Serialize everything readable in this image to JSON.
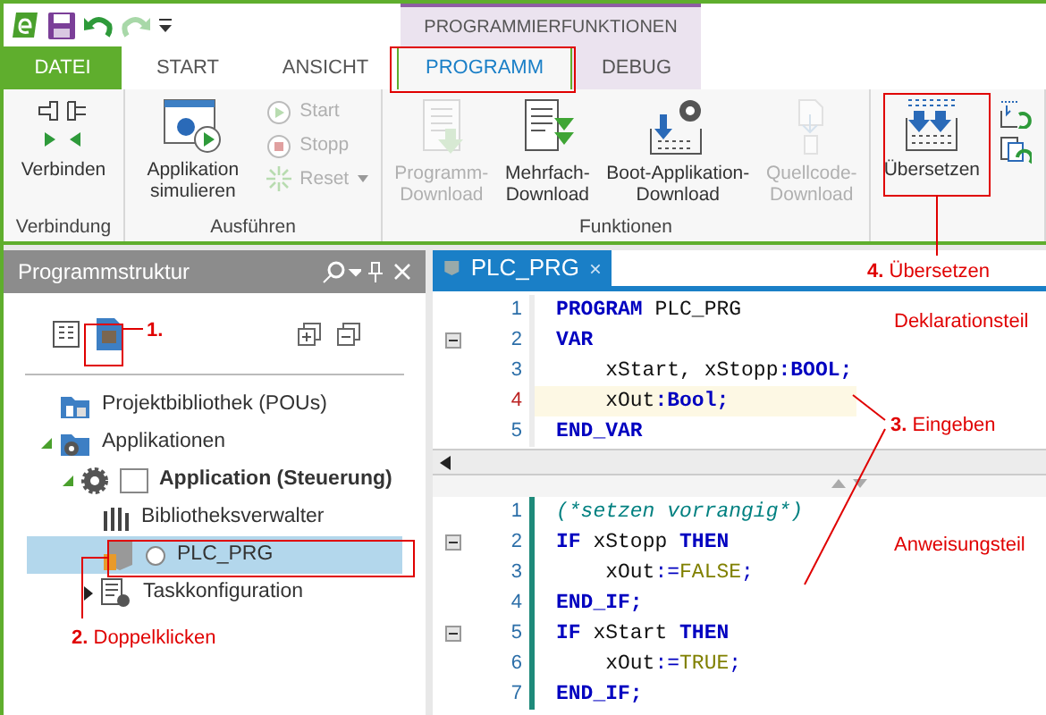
{
  "context_tab_group": "PROGRAMMIERFUNKTIONEN",
  "tabs": [
    {
      "label": "DATEI",
      "kind": "file",
      "selected": false
    },
    {
      "label": "START",
      "kind": "normal",
      "selected": false
    },
    {
      "label": "ANSICHT",
      "kind": "normal",
      "selected": false
    },
    {
      "label": "PROGRAMM",
      "kind": "context",
      "selected": true
    },
    {
      "label": "DEBUG",
      "kind": "context",
      "selected": false
    }
  ],
  "ribbon_groups": [
    {
      "label": "Verbindung",
      "items": [
        {
          "kind": "connect",
          "label": "Verbinden",
          "disabled": false
        }
      ]
    },
    {
      "label": "Ausführen",
      "items": [
        {
          "kind": "simulate",
          "label": "Applikation simulieren",
          "disabled": false
        }
      ],
      "small_items": [
        {
          "kind": "start",
          "label": "Start",
          "disabled": true,
          "dropdown": false
        },
        {
          "kind": "stop",
          "label": "Stopp",
          "disabled": true,
          "dropdown": false
        },
        {
          "kind": "reset",
          "label": "Reset",
          "disabled": true,
          "dropdown": true
        }
      ]
    },
    {
      "label": "Funktionen",
      "items": [
        {
          "kind": "download",
          "label": "Programm-Download",
          "disabled": true
        },
        {
          "kind": "multi",
          "label": "Mehrfach-Download",
          "disabled": false
        },
        {
          "kind": "boot",
          "label": "Boot-Applikation-Download",
          "disabled": false
        },
        {
          "kind": "source",
          "label": "Quellcode-Download",
          "disabled": true
        }
      ]
    },
    {
      "items": [
        {
          "kind": "compile",
          "label": "Übersetzen",
          "disabled": false
        }
      ],
      "icon_items": [
        {
          "kind": "rebuild"
        },
        {
          "kind": "clean"
        }
      ]
    }
  ],
  "structure_panel": {
    "title": "Programmstruktur",
    "tree": [
      {
        "label": "Projektbibliothek (POUs)",
        "kind": "library",
        "selected": false
      },
      {
        "label": "Applikationen",
        "kind": "apps",
        "expanded": true,
        "selected": false,
        "children": [
          {
            "label": "Application (Steuerung)",
            "kind": "application",
            "expanded": true,
            "selected": false,
            "children": [
              {
                "label": "Bibliotheksverwalter",
                "kind": "libmanager",
                "selected": false
              },
              {
                "label": "PLC_PRG",
                "kind": "pou",
                "selected": true
              },
              {
                "label": "Taskkonfiguration",
                "kind": "tasks",
                "expanded": false,
                "selected": false
              }
            ]
          }
        ]
      }
    ]
  },
  "editor": {
    "tab": "PLC_PRG",
    "declaration": [
      {
        "number": "1",
        "foldable": false,
        "current": false,
        "tokens": [
          {
            "kind": "keyword",
            "text": "PROGRAM"
          },
          {
            "kind": "ident",
            "text": " PLC_PRG"
          }
        ]
      },
      {
        "number": "2",
        "foldable": true,
        "current": false,
        "tokens": [
          {
            "kind": "keyword",
            "text": "VAR"
          }
        ]
      },
      {
        "number": "3",
        "foldable": false,
        "current": false,
        "tokens": [
          {
            "kind": "ident",
            "text": "    xStart, xStopp"
          },
          {
            "kind": "keyword",
            "text": ":BOOL;"
          }
        ]
      },
      {
        "number": "4",
        "foldable": false,
        "current": true,
        "tokens": [
          {
            "kind": "ident",
            "text": "    xOut"
          },
          {
            "kind": "keyword",
            "text": ":Bool;"
          }
        ]
      },
      {
        "number": "5",
        "foldable": false,
        "current": false,
        "tokens": [
          {
            "kind": "keyword",
            "text": "END_VAR"
          }
        ]
      }
    ],
    "implementation": [
      {
        "number": "1",
        "foldable": false,
        "current": false,
        "tokens": [
          {
            "kind": "comment",
            "text": "(*setzen vorrangig*)"
          }
        ]
      },
      {
        "number": "2",
        "foldable": true,
        "current": false,
        "tokens": [
          {
            "kind": "keyword",
            "text": "IF"
          },
          {
            "kind": "ident",
            "text": " xStopp "
          },
          {
            "kind": "keyword",
            "text": "THEN"
          }
        ]
      },
      {
        "number": "3",
        "foldable": false,
        "current": false,
        "tokens": [
          {
            "kind": "ident",
            "text": "    xOut"
          },
          {
            "kind": "op",
            "text": ":="
          },
          {
            "kind": "literal",
            "text": "FALSE"
          },
          {
            "kind": "op",
            "text": ";"
          }
        ]
      },
      {
        "number": "4",
        "foldable": false,
        "current": false,
        "tokens": [
          {
            "kind": "keyword",
            "text": "END_IF;"
          }
        ]
      },
      {
        "number": "5",
        "foldable": true,
        "current": false,
        "tokens": [
          {
            "kind": "keyword",
            "text": "IF"
          },
          {
            "kind": "ident",
            "text": " xStart "
          },
          {
            "kind": "keyword",
            "text": "THEN"
          }
        ]
      },
      {
        "number": "6",
        "foldable": false,
        "current": false,
        "tokens": [
          {
            "kind": "ident",
            "text": "    xOut"
          },
          {
            "kind": "op",
            "text": ":="
          },
          {
            "kind": "literal",
            "text": "TRUE"
          },
          {
            "kind": "op",
            "text": ";"
          }
        ]
      },
      {
        "number": "7",
        "foldable": false,
        "current": false,
        "tokens": [
          {
            "kind": "keyword",
            "text": "END_IF;"
          }
        ]
      }
    ]
  },
  "annotations": [
    {
      "number": "1."
    },
    {
      "number": "2.",
      "text": "Doppelklicken"
    },
    {
      "number": "3.",
      "text": "Eingeben"
    },
    {
      "number": "4.",
      "text": "Übersetzen"
    }
  ],
  "section_notes": [
    "Deklarationsteil",
    "Anweisungsteil"
  ]
}
